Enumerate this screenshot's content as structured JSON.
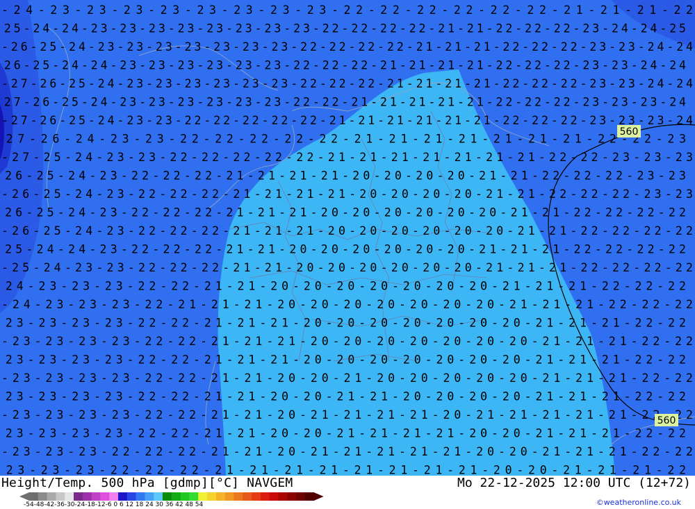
{
  "header": {
    "title_left": "Height/Temp. 500 hPa [gdmp][°C] NAVGEM",
    "title_right": "Mo 22-12-2025 12:00 UTC (12+72)",
    "credit": "©weatheronline.co.uk"
  },
  "legend": {
    "tick_labels": "-54-48-42-36-30-24-18-12-6  0  6  12  18  24  30  36  42  48  54",
    "colors": [
      "#6e6e6e",
      "#8c8c8c",
      "#aaaaaa",
      "#c8c8c8",
      "#e6e6e6",
      "#7a2a8a",
      "#9b30a8",
      "#c040c8",
      "#e050e0",
      "#f080f0",
      "#1e14c8",
      "#2846e6",
      "#3278f0",
      "#46a0f5",
      "#5ac8fa",
      "#0a8c0a",
      "#14aa14",
      "#1ec81e",
      "#32dc32",
      "#f0f032",
      "#f5d22d",
      "#f5b428",
      "#f09623",
      "#eb781e",
      "#e65a19",
      "#e63c14",
      "#dc1e0f",
      "#c80a0a",
      "#aa0505",
      "#8c0000",
      "#6e0000",
      "#500000"
    ]
  },
  "map": {
    "labels": {
      "contour_560": "560"
    },
    "temperature_rows": [
      "-24-23-23-23-23-23-23-23-23-22-22-22-22-22-22-21-21-21-22",
      "-25-24-24-23-23-23-23-23-23-23-23-22-22-22-22-21-21-22-22-22-23-24-24-25",
      "-26-25-24-23-23-23-23-23-23-23-22-22-22-22-21-21-21-22-22-22-23-23-24-24",
      "-26-25-24-24-23-23-23-23-23-23-22-22-22-21-21-21-21-22-22-22-23-23-24-24",
      "-27-26-25-24-23-23-23-23-23-23-22-22-22-21-21-21-21-22-22-22-23-23-24-24",
      "-27-26-25-24-23-23-23-23-23-23-22-22-21-21-21-21-21-22-22-22-23-23-23-24",
      "-27-26-25-24-23-23-22-22-22-22-22-21-21-21-21-21-21-22-22-22-23-23-23-24",
      "-27-26-24-23-23-22-22-22-22-22-21-21-21-21-21-21-21-22-22-23",
      "-27-25-24-23-23-22-22-22-22-22-21-21-21-21-21-21-21-22-22-23-23-23",
      "-26-25-24-23-22-22-22-21-21-21-21-20-20-20-20-21-21-22-22-22-23-23",
      "-26-25-24-23-22-22-22-21-21-21-21-20-20-20-20-21-21-22-22-22-23-23",
      "-26-25-24-23-22-22-22-21-21-21-20-20-20-20-20-20-21-21-22-22-22-22",
      "-26-25-24-23-22-22-22-21-21-21-20-20-20-20-20-20-21-21-22-22-22-22",
      "-25-24-24-23-22-22-22-21-21-20-20-20-20-20-20-21-21-21-22-22-22-22",
      "-25-24-23-23-22-22-22-21-21-20-20-20-20-20-20-21-21-21-22-22-22-22",
      "-24-23-23-23-22-22-21-21-20-20-20-20-20-20-20-21-21-21-22-22-22",
      "-24-23-23-23-22-21-21-21-20-20-20-20-20-20-20-21-21-21-22-22-22",
      "-23-23-23-23-22-22-21-21-21-20-20-20-20-20-20-20-21-21-21-22-22",
      "-23-23-23-23-22-22-21-21-21-20-20-20-20-20-20-20-21-21-21-22-22",
      "-23-23-23-23-22-22-21-21-21-20-20-20-20-20-20-20-21-21-21-22-22",
      "-23-23-23-23-22-22-21-21-20-20-21-20-20-20-20-20-21-21-21-22-22",
      "-23-23-23-23-22-22-21-21-20-20-21-21-20-20-20-20-21-21-21-22-22",
      "-23-23-23-23-22-22-21-21-20-21-21-21-21-20-21-21-21-21-21-22-22",
      "-23-23-23-23-22-22-21-21-20-20-21-21-21-21-20-20-21-21-21-22-22",
      "-23-23-23-22-22-22-21-21-20-21-21-21-21-21-20-20-21-21-21-22-22",
      "-23-23-23-22-22-22-21-21-21-21-21-21-21-21-20-20-21-21-21-22"
    ]
  }
}
